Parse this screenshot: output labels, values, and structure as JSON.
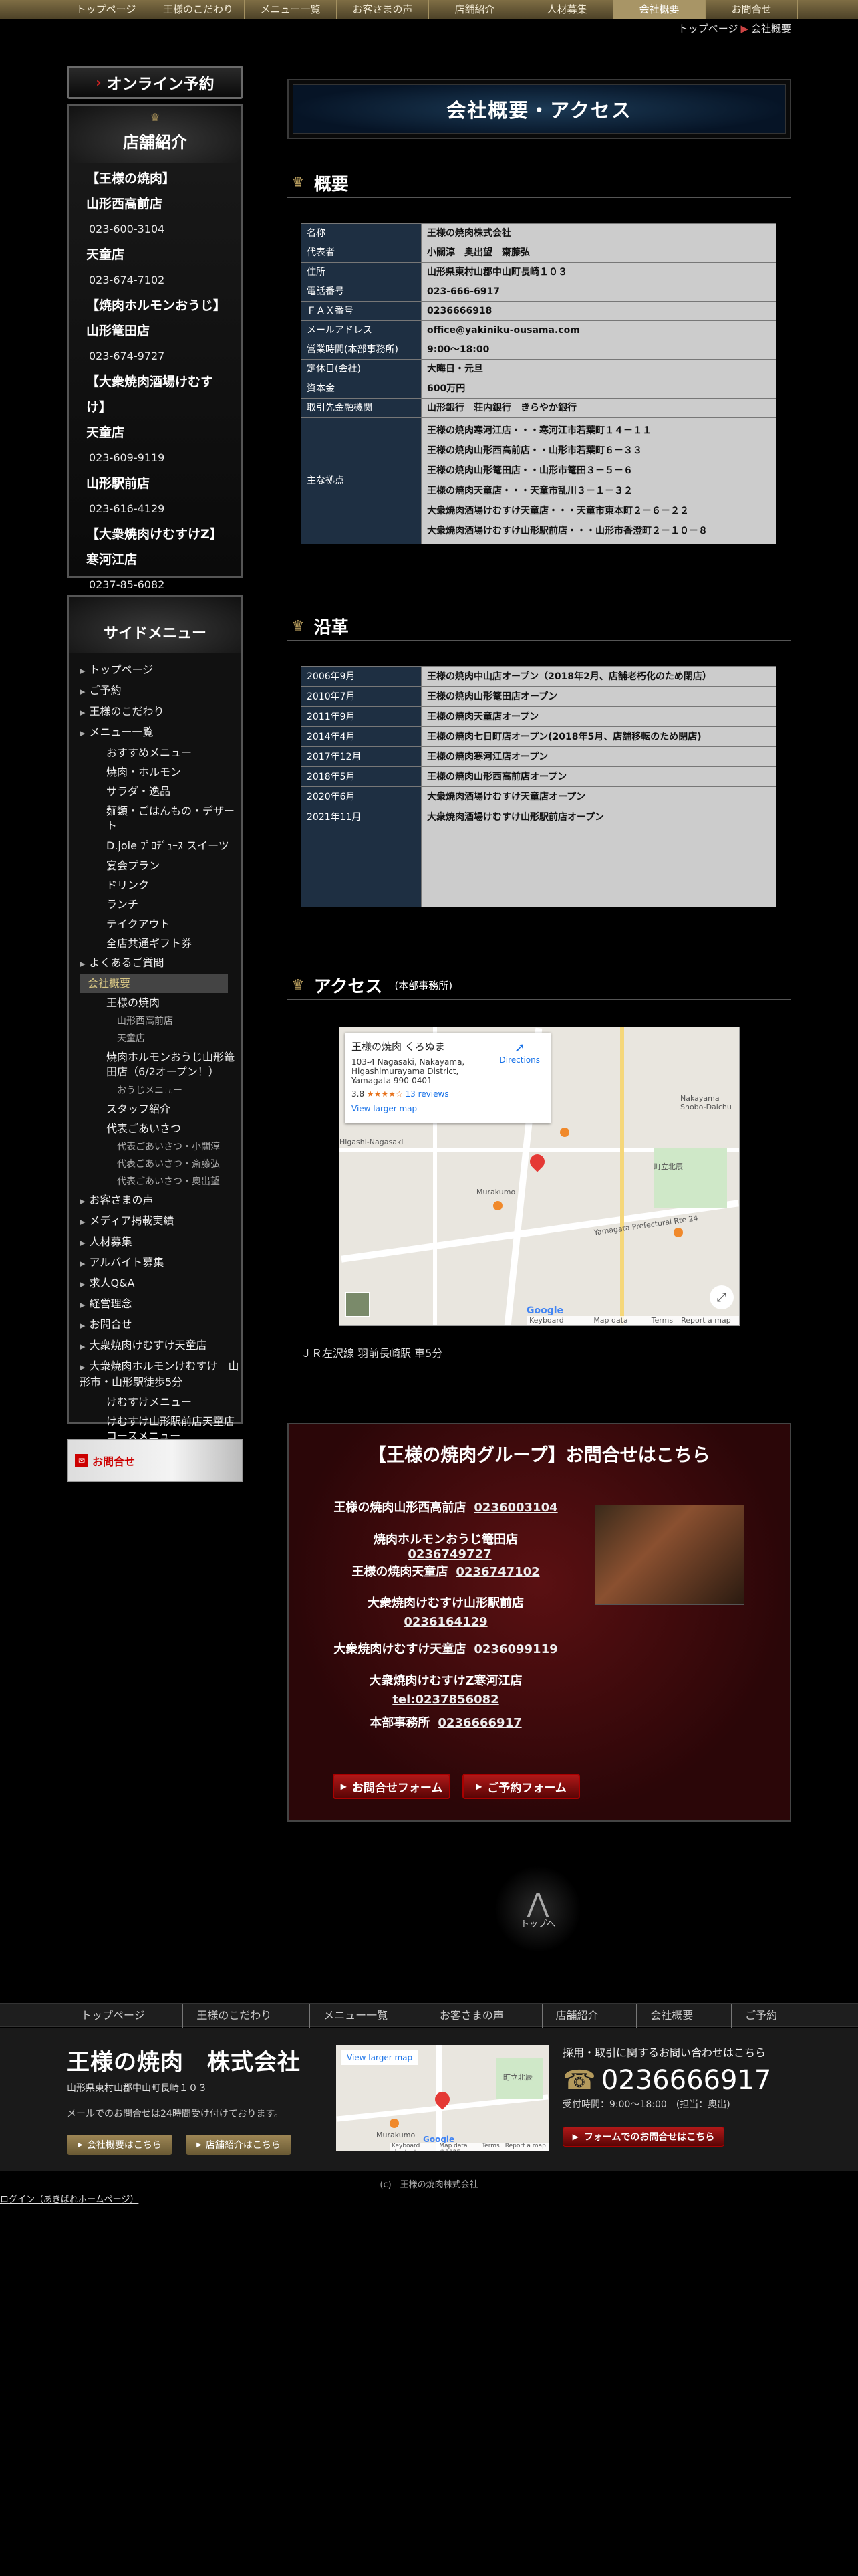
{
  "topnav": [
    "トップページ",
    "王様のこだわり",
    "メニュー一覧",
    "お客さまの声",
    "店舗紹介",
    "人材募集",
    "会社概要",
    "お問合せ"
  ],
  "breadcrumb": {
    "home": "トップページ",
    "current": "会社概要",
    "sep": "▶"
  },
  "online": {
    "label": "オンライン予約",
    "arrow": "›"
  },
  "stores": {
    "title": "店舗紹介",
    "ornament": "♛",
    "items": [
      {
        "text": "【王様の焼肉】",
        "type": "line"
      },
      {
        "text": "山形西高前店",
        "type": "line"
      },
      {
        "text": "023-600-3104",
        "type": "tel"
      },
      {
        "text": "天童店",
        "type": "line"
      },
      {
        "text": "023-674-7102",
        "type": "tel"
      },
      {
        "text": "【焼肉ホルモンおうじ】",
        "type": "line"
      },
      {
        "text": "山形篭田店",
        "type": "line"
      },
      {
        "text": "023-674-9727",
        "type": "tel"
      },
      {
        "text": "【大衆焼肉酒場けむすけ】",
        "type": "line"
      },
      {
        "text": "天童店",
        "type": "line"
      },
      {
        "text": "023-609-9119",
        "type": "tel"
      },
      {
        "text": "山形駅前店",
        "type": "line"
      },
      {
        "text": "023-616-4129",
        "type": "tel"
      },
      {
        "text": "【大衆焼肉けむすけZ】",
        "type": "line"
      },
      {
        "text": "寒河江店",
        "type": "line"
      },
      {
        "text": "0237-85-6082",
        "type": "tel"
      }
    ]
  },
  "side": {
    "title": "サイドメニュー",
    "items": [
      {
        "t": "トップページ",
        "lv": 1
      },
      {
        "t": "ご予約",
        "lv": 1
      },
      {
        "t": "王様のこだわり",
        "lv": 1
      },
      {
        "t": "メニュー一覧",
        "lv": 1
      },
      {
        "t": "おすすめメニュー",
        "lv": 2
      },
      {
        "t": "焼肉・ホルモン",
        "lv": 2
      },
      {
        "t": "サラダ・逸品",
        "lv": 2
      },
      {
        "t": "麺類・ごはんもの・デザート",
        "lv": 2,
        "wrap": true
      },
      {
        "t": "D.joie ﾌﾟﾛﾃﾞｭｰｽ スイーツ",
        "lv": 2,
        "wrap": true
      },
      {
        "t": "宴会プラン",
        "lv": 2
      },
      {
        "t": "ドリンク",
        "lv": 2
      },
      {
        "t": "ランチ",
        "lv": 2
      },
      {
        "t": "テイクアウト",
        "lv": 2
      },
      {
        "t": "全店共通ギフト券",
        "lv": 2
      },
      {
        "t": "よくあるご質問",
        "lv": 1
      },
      {
        "t": "会社概要",
        "lv": 1,
        "active": true
      },
      {
        "t": "王様の焼肉",
        "lv": 2
      },
      {
        "t": "山形西高前店",
        "lv": 3
      },
      {
        "t": "天童店",
        "lv": 3
      },
      {
        "t": "焼肉ホルモンおうじ山形篭田店（6/2オープン！）",
        "lv": 2,
        "wrap": true
      },
      {
        "t": "おうじメニュー",
        "lv": 3
      },
      {
        "t": "スタッフ紹介",
        "lv": 2
      },
      {
        "t": "代表ごあいさつ",
        "lv": 2
      },
      {
        "t": "代表ごあいさつ・小關淳",
        "lv": 3
      },
      {
        "t": "代表ごあいさつ・斎藤弘",
        "lv": 3
      },
      {
        "t": "代表ごあいさつ・奥出望",
        "lv": 3
      },
      {
        "t": "お客さまの声",
        "lv": 1
      },
      {
        "t": "メディア掲載実績",
        "lv": 1
      },
      {
        "t": "人材募集",
        "lv": 1
      },
      {
        "t": "アルバイト募集",
        "lv": 1
      },
      {
        "t": "求人Q&A",
        "lv": 1
      },
      {
        "t": "経営理念",
        "lv": 1
      },
      {
        "t": "お問合せ",
        "lv": 1
      },
      {
        "t": "大衆焼肉けむすけ天童店",
        "lv": 1
      },
      {
        "t": "大衆焼肉ホルモンけむすけ｜山形市・山形駅徒歩5分",
        "lv": 1,
        "wrap": true
      },
      {
        "t": "けむすけメニュー",
        "lv": 2
      },
      {
        "t": "けむすけ山形駅前店天童店コースメニュー",
        "lv": 2,
        "wrap": true
      }
    ]
  },
  "contact_banner": {
    "label": "お問合せ",
    "icon": "✉"
  },
  "page_title": "会社概要・アクセス",
  "overview": {
    "heading": "概要",
    "rows": [
      [
        "名称",
        "王様の焼肉株式会社"
      ],
      [
        "代表者",
        "小關淳　奥出望　齋藤弘"
      ],
      [
        "住所",
        "山形県東村山郡中山町長崎１０３"
      ],
      [
        "電話番号",
        "023-666-6917"
      ],
      [
        "ＦＡＸ番号",
        "0236666918"
      ],
      [
        "メールアドレス",
        " office@yakiniku-ousama.com"
      ],
      [
        "営業時間(本部事務所)",
        "  9:00～18:00"
      ],
      [
        "定休日(会社)",
        "大晦日・元旦"
      ],
      [
        "資本金",
        "600万円"
      ],
      [
        "取引先金融機関",
        "山形銀行　荘内銀行　きらやか銀行"
      ]
    ],
    "bases_label": "主な拠点",
    "bases": [
      "王様の焼肉寒河江店・・・寒河江市若葉町１４－１１",
      "王様の焼肉山形西高前店・・山形市若葉町６－３３",
      "王様の焼肉山形篭田店・・山形市篭田３－５－６",
      "王様の焼肉天童店・・・天童市乱川３－１－３２",
      "大衆焼肉酒場けむすけ天童店・・・天童市東本町２－６－２２",
      "大衆焼肉酒場けむすけ山形駅前店・・・山形市香澄町２－１０－８"
    ]
  },
  "history": {
    "heading": "沿革",
    "rows": [
      [
        "2006年9月",
        "王様の焼肉中山店オープン（2018年2月、店舗老朽化のため閉店）"
      ],
      [
        "2010年7月",
        "王様の焼肉山形篭田店オープン"
      ],
      [
        "2011年9月",
        "王様の焼肉天童店オープン"
      ],
      [
        "2014年4月",
        "王様の焼肉七日町店オープン(2018年5月、店舗移転のため閉店)"
      ],
      [
        "2017年12月",
        "王様の焼肉寒河江店オープン"
      ],
      [
        "2018年5月",
        "王様の焼肉山形西高前店オープン"
      ],
      [
        "2020年6月",
        "大衆焼肉酒場けむすけ天童店オープン"
      ],
      [
        "2021年11月",
        "大衆焼肉酒場けむすけ山形駅前店オープン"
      ],
      [
        "",
        ""
      ],
      [
        "",
        ""
      ],
      [
        "",
        ""
      ],
      [
        "",
        ""
      ]
    ]
  },
  "access": {
    "heading": "アクセス",
    "sub": "(本部事務所)",
    "map": {
      "name": "王様の焼肉 くろぬま",
      "addr": "103-4 Nagasaki, Nakayama, Higashimurayama District, Yamagata 990-0401",
      "rating": "3.8",
      "stars": "★★★★☆",
      "reviews": "13 reviews",
      "directions": "Directions",
      "larger": "View larger map",
      "labels": [
        "Yamagata Prefectural Rte 24",
        "Nakayama Shobo-Daichu",
        "Murakumo",
        "Higashi-Nagasaki",
        "町立北辰",
        "Google",
        "Keyboard shortcuts",
        "Map data ©2025",
        "Terms",
        "Report a map error"
      ]
    },
    "text": "ＪＲ左沢線 羽前長崎駅 車5分"
  },
  "group": {
    "heading": "【王様の焼肉グループ】お問合せはこちら",
    "rows": [
      {
        "name": "王様の焼肉山形西高前店",
        "tel": "0236003104"
      },
      {
        "name": "焼肉ホルモンおうじ篭田店",
        "tel": "0236749727"
      },
      {
        "name": "王様の焼肉天童店",
        "tel": "0236747102"
      },
      {
        "name": "大衆焼肉けむすけ山形駅前店",
        "tel": "0236164129"
      },
      {
        "name": "大衆焼肉けむすけ天童店",
        "tel": "0236099119"
      },
      {
        "name": "大衆焼肉けむすけZ寒河江店",
        "tel": "tel:0237856082"
      },
      {
        "name": "本部事務所",
        "tel": "0236666917"
      }
    ],
    "btn_contact": "お問合せフォーム",
    "btn_reserve": "ご予約フォーム"
  },
  "totop": "トップへ",
  "fnav": [
    "トップページ",
    "王様のこだわり",
    "メニュー一覧",
    "お客さまの声",
    "店舗紹介",
    "会社概要",
    "ご予約"
  ],
  "footer": {
    "company": "王様の焼肉　株式会社",
    "addr": "山形県東村山郡中山町長崎１０３",
    "mail": "メールでのお問合せは24時間受け付けております。",
    "btn_company": "会社概要はこちら",
    "btn_stores": "店舗紹介はこちら",
    "map_larger": "View larger map",
    "map_labels": [
      "Murakumo",
      "町立北辰",
      "Google",
      "Keyboard shortcuts",
      "Map data ©2025",
      "Terms",
      "Report a map error"
    ],
    "contact_lead": "採用・取引に関するお問い合わせはこちら",
    "tel": "0236666917",
    "hours": "受付時間：9:00～18:00　(担当：奥出)",
    "form_btn": "フォームでのお問合せはこちら"
  },
  "copyright": "(c)　王様の焼肉株式会社",
  "login": "ログイン（あきばれホームページ）"
}
